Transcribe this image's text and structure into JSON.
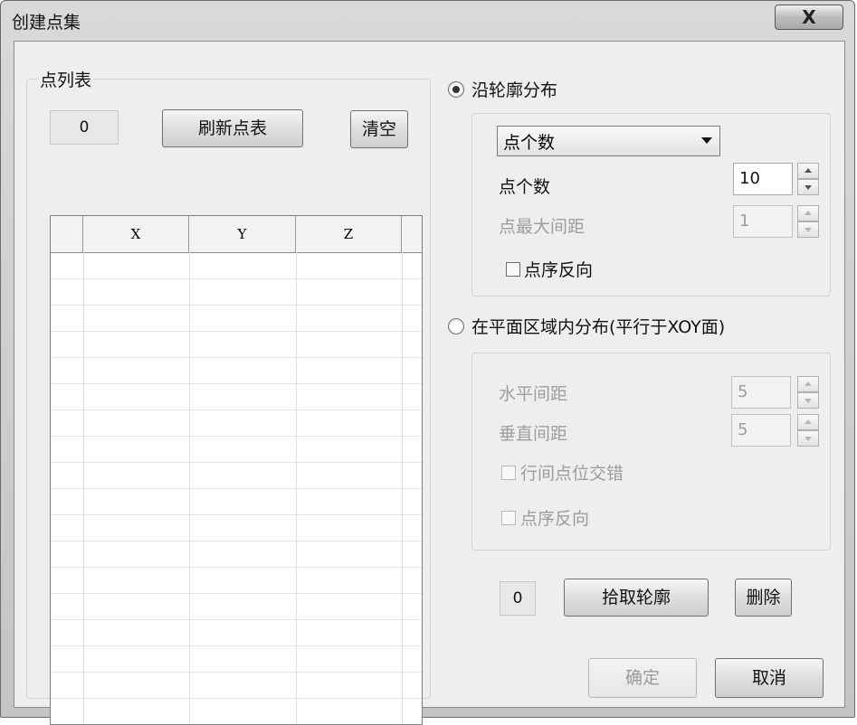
{
  "window": {
    "title": "创建点集",
    "close_glyph": "X"
  },
  "point_list": {
    "legend": "点列表",
    "count": "0",
    "refresh_label": "刷新点表",
    "clear_label": "清空",
    "columns": [
      "",
      "X",
      "Y",
      "Z",
      ""
    ]
  },
  "contour": {
    "radio_label": "沿轮廓分布",
    "selected": true,
    "mode_select": "点个数",
    "point_count_label": "点个数",
    "point_count_value": "10",
    "max_spacing_label": "点最大间距",
    "max_spacing_value": "1",
    "reverse_label": "点序反向"
  },
  "plane": {
    "radio_label": "在平面区域内分布(平行于XOY面)",
    "selected": false,
    "h_spacing_label": "水平间距",
    "h_spacing_value": "5",
    "v_spacing_label": "垂直间距",
    "v_spacing_value": "5",
    "stagger_label": "行间点位交错",
    "reverse_label": "点序反向"
  },
  "pick": {
    "count": "0",
    "pick_label": "拾取轮廓",
    "delete_label": "删除"
  },
  "footer": {
    "ok_label": "确定",
    "cancel_label": "取消"
  }
}
